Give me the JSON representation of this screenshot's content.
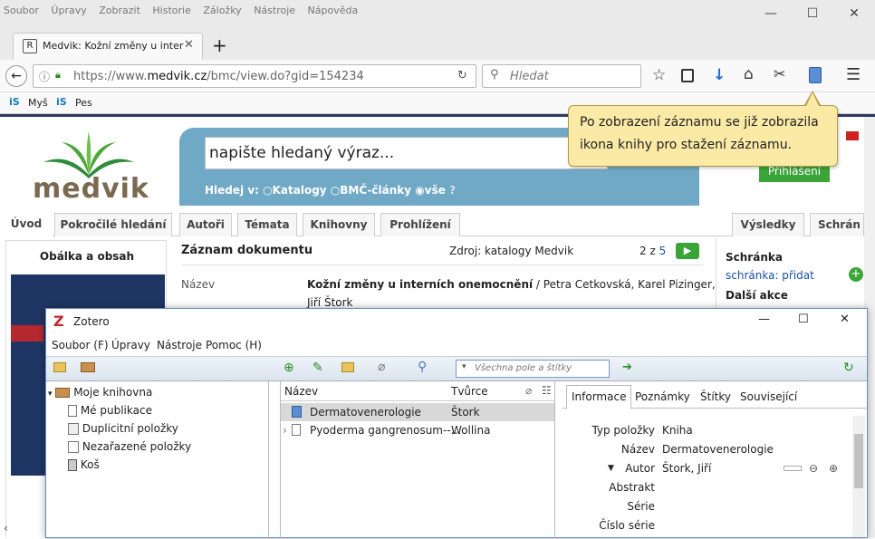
{
  "browser": {
    "menu": [
      "Soubor",
      "Úpravy",
      "Zobrazit",
      "Historie",
      "Záložky",
      "Nástroje",
      "Nápověda"
    ],
    "tab_title": "Medvik: Kožní změny u inter",
    "url_prefix": "https://www.",
    "url_domain": "medvik.cz",
    "url_path": "/bmc/view.do?gid=154234",
    "search_placeholder": "Hledat",
    "bookmarks": [
      "Myš",
      "Pes"
    ],
    "bookmark_icon_glyph": "iS",
    "window_controls": [
      "—",
      "☐",
      "✕"
    ]
  },
  "medvik": {
    "logo": "medvik",
    "search_value": "napište hledaný výraz...",
    "search_in_label": "Hledej v:",
    "search_options": [
      "Katalogy",
      "BMČ-články",
      "vše"
    ],
    "login_button": "Přihlášení",
    "nav_tabs": [
      "Úvod",
      "Pokročilé hledání",
      "Autoři",
      "Témata",
      "Knihovny",
      "Prohlížení",
      "Výsledky",
      "Schrán"
    ],
    "left_col_title": "Obálka a obsah",
    "record_title": "Záznam dokumentu",
    "source": "Zdroj: katalogy Medvik",
    "paging_current": "2",
    "paging_of": "z",
    "paging_total": "5",
    "field_name_label": "Název",
    "field_name_value_bold": "Kožní změny u interních onemocnění",
    "field_name_value_rest": " / Petra Cetkovská, Karel Pizinger,",
    "field_name_value_line2": "Jiří Štork",
    "box_title": "Schránka",
    "box_link": "schránka: přidat",
    "more_actions": "Další akce"
  },
  "callout": {
    "text": "Po zobrazení záznamu se již zobrazila ikona knihy pro stažení záznamu."
  },
  "zotero": {
    "title": "Zotero",
    "menu": [
      "Soubor (F)",
      "Úpravy",
      "Nástroje",
      "Pomoc (H)"
    ],
    "search_placeholder": "Všechna pole a štítky",
    "library_root": "Moje knihovna",
    "library_items": [
      "Mé publikace",
      "Duplicitní položky",
      "Nezařazené položky",
      "Koš"
    ],
    "col_title": "Název",
    "col_creator": "Tvůrce",
    "items": [
      {
        "title": "Dermatovenerologie",
        "creator": "Štork"
      },
      {
        "title": "Pyoderma gangrenosum--...",
        "creator": "Wollina"
      }
    ],
    "tabs": [
      "Informace",
      "Poznámky",
      "Štítky",
      "Související"
    ],
    "info_fields": [
      {
        "label": "Typ položky",
        "value": "Kniha"
      },
      {
        "label": "Název",
        "value": "Dermatovenerologie"
      },
      {
        "label": "Autor",
        "value": "Štork, Jiří"
      },
      {
        "label": "Abstrakt",
        "value": ""
      },
      {
        "label": "Série",
        "value": ""
      },
      {
        "label": "Číslo série",
        "value": ""
      }
    ]
  }
}
